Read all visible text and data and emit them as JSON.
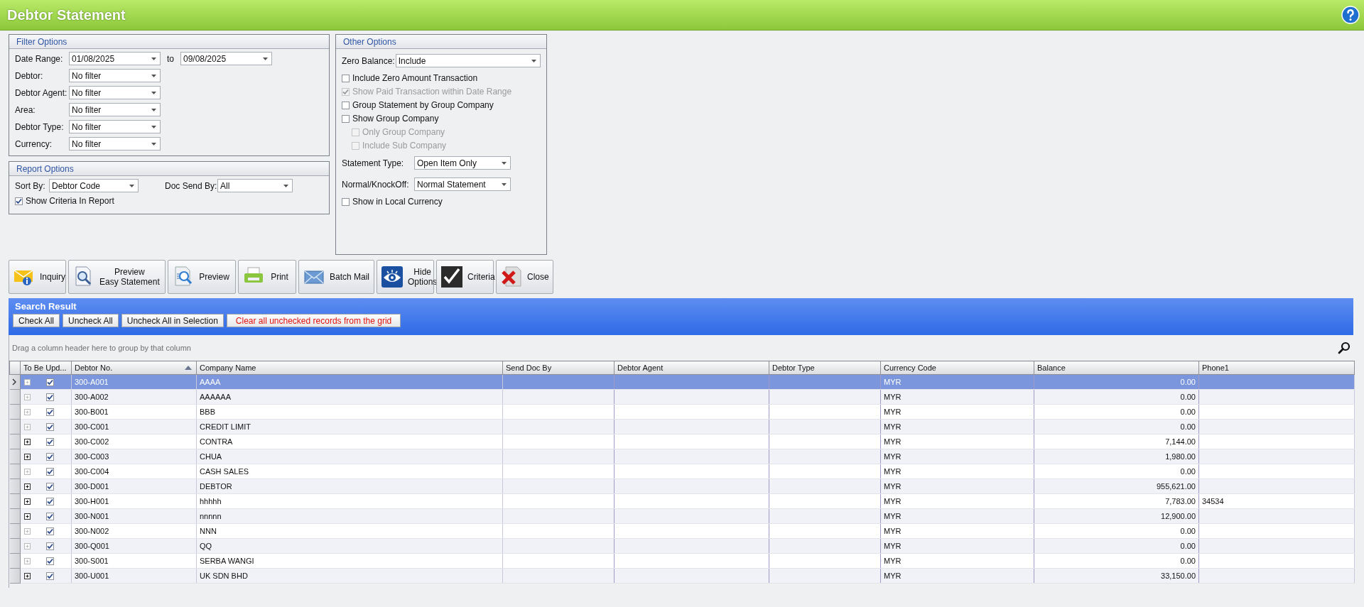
{
  "window": {
    "title": "Debtor Statement"
  },
  "filter_options": {
    "title": "Filter Options",
    "fields": [
      {
        "label": "Date Range:",
        "value": "01/08/2025",
        "to_label": "to",
        "to_value": "09/08/2025"
      },
      {
        "label": "Debtor:",
        "value": "No filter"
      },
      {
        "label": "Debtor Agent:",
        "value": "No filter"
      },
      {
        "label": "Area:",
        "value": "No filter"
      },
      {
        "label": "Debtor Type:",
        "value": "No filter"
      },
      {
        "label": "Currency:",
        "value": "No filter"
      }
    ]
  },
  "report_options": {
    "title": "Report Options",
    "sort_by": {
      "label": "Sort By:",
      "value": "Debtor Code"
    },
    "doc_send_by": {
      "label": "Doc Send By:",
      "value": "All"
    },
    "checkboxes": [
      {
        "label": "Show Criteria In Report",
        "checked": true,
        "disabled": false
      }
    ]
  },
  "other_options": {
    "title": "Other Options",
    "items": [
      {
        "kind": "combo",
        "label": "Zero Balance:",
        "value": "Include"
      },
      {
        "kind": "check",
        "label": "Include Zero Amount Transaction",
        "checked": false,
        "disabled": false
      },
      {
        "kind": "check",
        "label": "Show Paid Transaction within Date Range",
        "checked": true,
        "disabled": true
      },
      {
        "kind": "check",
        "label": "Group Statement by Group Company",
        "checked": false,
        "disabled": false
      },
      {
        "kind": "check",
        "label": "Show Group Company",
        "checked": false,
        "disabled": false,
        "children": [
          {
            "kind": "check",
            "label": "Only Group Company",
            "checked": false,
            "disabled": true
          },
          {
            "kind": "check",
            "label": "Include Sub Company",
            "checked": false,
            "disabled": true
          }
        ]
      },
      {
        "kind": "combo",
        "label": "Statement Type:",
        "value": "Open Item Only"
      },
      {
        "kind": "combo",
        "label": "Normal/KnockOff:",
        "value": "Normal Statement"
      },
      {
        "kind": "check",
        "label": "Show in Local Currency",
        "checked": false,
        "disabled": false
      }
    ]
  },
  "toolbar": [
    {
      "kind": "inquiry",
      "label": "Inquiry"
    },
    {
      "kind": "preview-easy",
      "label": "Preview\nEasy Statement"
    },
    {
      "kind": "preview",
      "label": "Preview"
    },
    {
      "kind": "print",
      "label": "Print"
    },
    {
      "kind": "mail",
      "label": "Batch Mail"
    },
    {
      "kind": "hide",
      "label": "Hide\nOptions"
    },
    {
      "kind": "criteria",
      "label": "Criteria"
    },
    {
      "kind": "close",
      "label": "Close"
    }
  ],
  "search_result": {
    "title": "Search Result",
    "buttons": [
      {
        "kind": "normal",
        "label": "Check All"
      },
      {
        "kind": "normal",
        "label": "Uncheck All"
      },
      {
        "kind": "normal",
        "label": "Uncheck All in Selection"
      },
      {
        "kind": "warning",
        "label": "Clear all unchecked records from the grid"
      }
    ]
  },
  "grid": {
    "group_hint": "Drag a column header here to group by that column",
    "columns": [
      {
        "label": "To Be Upd...",
        "sorted": false
      },
      {
        "label": "Debtor No.",
        "sorted": true
      },
      {
        "label": "Company Name",
        "sorted": false
      },
      {
        "label": "Send Doc By",
        "sorted": false
      },
      {
        "label": "Debtor Agent",
        "sorted": false
      },
      {
        "label": "Debtor Type",
        "sorted": false
      },
      {
        "label": "Currency Code",
        "sorted": false
      },
      {
        "label": "Balance",
        "sorted": false
      },
      {
        "label": "Phone1",
        "sorted": false
      }
    ],
    "rows": [
      {
        "selected": true,
        "expandable": false,
        "checked": true,
        "debtor_no": "300-A001",
        "company_name": "AAAA",
        "currency_code": "MYR",
        "balance": "0.00"
      },
      {
        "selected": false,
        "expandable": false,
        "checked": true,
        "debtor_no": "300-A002",
        "company_name": "AAAAAA",
        "currency_code": "MYR",
        "balance": "0.00"
      },
      {
        "selected": false,
        "expandable": false,
        "checked": true,
        "debtor_no": "300-B001",
        "company_name": "BBB",
        "currency_code": "MYR",
        "balance": "0.00"
      },
      {
        "selected": false,
        "expandable": false,
        "checked": true,
        "debtor_no": "300-C001",
        "company_name": "CREDIT LIMIT",
        "currency_code": "MYR",
        "balance": "0.00"
      },
      {
        "selected": false,
        "expandable": true,
        "checked": true,
        "debtor_no": "300-C002",
        "company_name": "CONTRA",
        "currency_code": "MYR",
        "balance": "7,144.00"
      },
      {
        "selected": false,
        "expandable": true,
        "checked": true,
        "debtor_no": "300-C003",
        "company_name": "CHUA",
        "currency_code": "MYR",
        "balance": "1,980.00"
      },
      {
        "selected": false,
        "expandable": false,
        "checked": true,
        "debtor_no": "300-C004",
        "company_name": "CASH SALES",
        "currency_code": "MYR",
        "balance": "0.00"
      },
      {
        "selected": false,
        "expandable": true,
        "checked": true,
        "debtor_no": "300-D001",
        "company_name": "DEBTOR",
        "currency_code": "MYR",
        "balance": "955,621.00"
      },
      {
        "selected": false,
        "expandable": true,
        "checked": true,
        "debtor_no": "300-H001",
        "company_name": "hhhhh",
        "currency_code": "MYR",
        "balance": "7,783.00",
        "phone1": "34534"
      },
      {
        "selected": false,
        "expandable": true,
        "checked": true,
        "debtor_no": "300-N001",
        "company_name": "nnnnn",
        "currency_code": "MYR",
        "balance": "12,900.00"
      },
      {
        "selected": false,
        "expandable": false,
        "checked": true,
        "debtor_no": "300-N002",
        "company_name": "NNN",
        "currency_code": "MYR",
        "balance": "0.00"
      },
      {
        "selected": false,
        "expandable": false,
        "checked": true,
        "debtor_no": "300-Q001",
        "company_name": "QQ",
        "currency_code": "MYR",
        "balance": "0.00"
      },
      {
        "selected": false,
        "expandable": false,
        "checked": true,
        "debtor_no": "300-S001",
        "company_name": "SERBA WANGI",
        "currency_code": "MYR",
        "balance": "0.00"
      },
      {
        "selected": false,
        "expandable": true,
        "checked": true,
        "debtor_no": "300-U001",
        "company_name": "UK SDN BHD",
        "currency_code": "MYR",
        "balance": "33,150.00"
      }
    ]
  }
}
